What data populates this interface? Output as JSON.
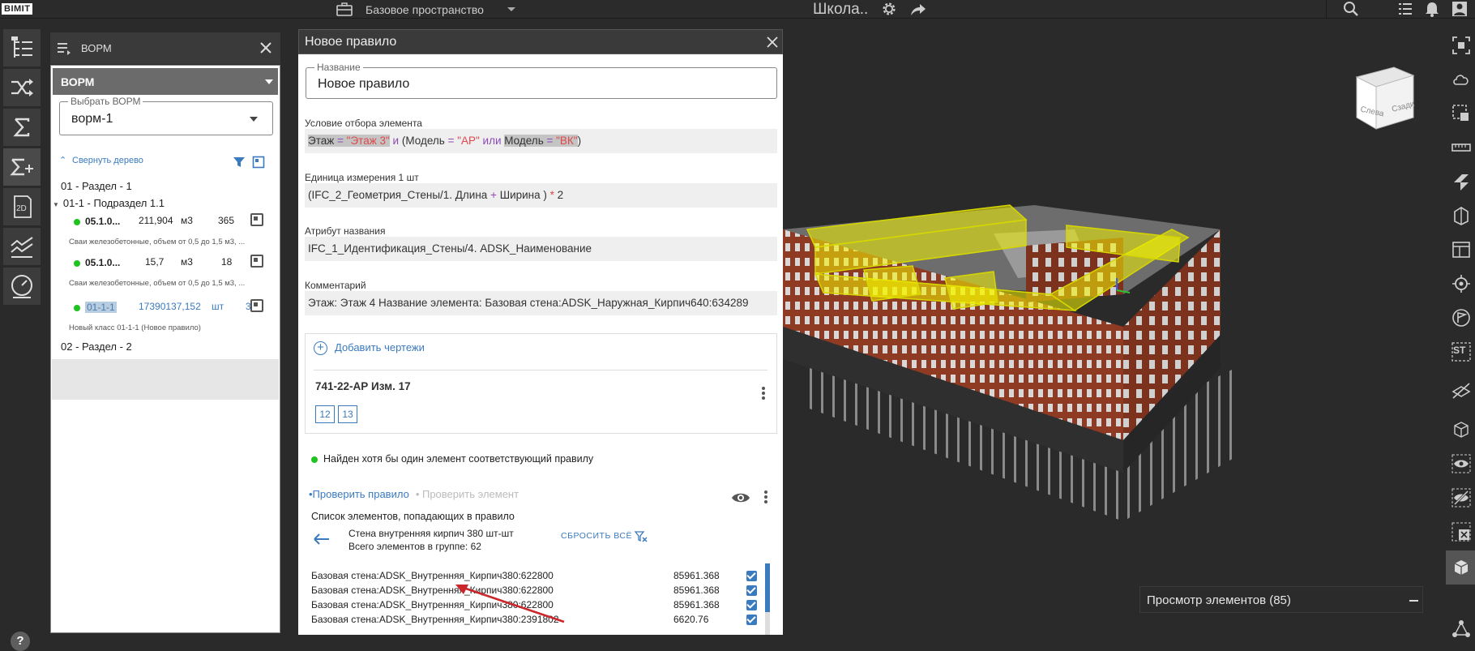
{
  "topbar": {
    "logo": "BIMIT",
    "space": "Базовое пространство",
    "project": "Школа.."
  },
  "vorm": {
    "header_title": "ВОРМ",
    "bar_label": "ВОРМ",
    "select_legend": "Выбрать ВОРМ",
    "select_value": "ворм-1",
    "collapse_label": "Свернуть дерево",
    "tree": {
      "section1": "01 - Раздел - 1",
      "subsection": "01-1 - Подраздел 1.1",
      "rows": [
        {
          "code": "05.1.0...",
          "value": "211,904",
          "unit": "м3",
          "count": "365",
          "desc": "Сваи железобетонные, объем от 0,5 до 1,5 м3, ..."
        },
        {
          "code": "05.1.0...",
          "value": "15,7",
          "unit": "м3",
          "count": "18",
          "desc": "Сваи железобетонные, объем от 0,5 до 1,5 м3, ..."
        },
        {
          "code": "01-1-1",
          "value": "17390137,152",
          "unit": "шт",
          "count": "3",
          "desc": "Новый класс 01-1-1 (Новое правило)"
        }
      ],
      "section2": "02 - Раздел - 2"
    }
  },
  "rule": {
    "title": "Новое правило",
    "name_legend": "Название",
    "name_value": "Новое правило",
    "condition_label": "Условие отбора элемента",
    "condition": {
      "t1": "Этаж",
      "op1": " = ",
      "v1": "\"Этаж 3\"",
      "and": " и ",
      "paren_open": "(",
      "t2": "Модель",
      "op2": " = ",
      "v2": "\"АР\"",
      "or": " или ",
      "t3": "Модель",
      "op3": " = ",
      "v3": "\"ВК\"",
      "paren_close": ")"
    },
    "unit_label": "Единица измерения 1 шт",
    "unit_formula": {
      "a": "(IFC_2_Геометрия_Стены/1. Длина ",
      "plus": "+",
      "b": " Ширина ) ",
      "mul": "*",
      "c": " 2"
    },
    "attr_label": "Атрибут названия",
    "attr_value": "IFC_1_Идентификация_Стены/4. ADSK_Наименование",
    "comment_label": "Комментарий",
    "comment_value": "Этаж: Этаж 4 Название элемента: Базовая стена:ADSK_Наружная_Кирпич640:634289",
    "add_drawings": "Добавить чертежи",
    "drawing_title": "741-22-АР Изм. 17",
    "sheets": [
      "12",
      "13"
    ],
    "found_text": "Найден хотя бы один элемент соответствующий правилу",
    "tab_check_rule": "•Проверить правило",
    "tab_check_element": "• Проверить элемент",
    "list_title": "Список элементов, попадающих в правило",
    "group_name": "Стена внутренняя кирпич 380 шт-шт",
    "group_count": "Всего элементов в группе: 62",
    "reset_all": "СБРОСИТЬ ВСЁ",
    "elements": [
      {
        "name": "Базовая стена:ADSK_Внутренняя_Кирпич380:622800",
        "value": "85961.368"
      },
      {
        "name": "Базовая стена:ADSK_Внутренняя_Кирпич380:622800",
        "value": "85961.368"
      },
      {
        "name": "Базовая стена:ADSK_Внутренняя_Кирпич380:622800",
        "value": "85961.368"
      },
      {
        "name": "Базовая стена:ADSK_Внутренняя_Кирпич380:2391802",
        "value": "6620.76"
      }
    ]
  },
  "viewport": {
    "cube_left": "Слева",
    "cube_front": "Сзади",
    "preview_title": "Просмотр элементов (85)"
  },
  "help": "?"
}
